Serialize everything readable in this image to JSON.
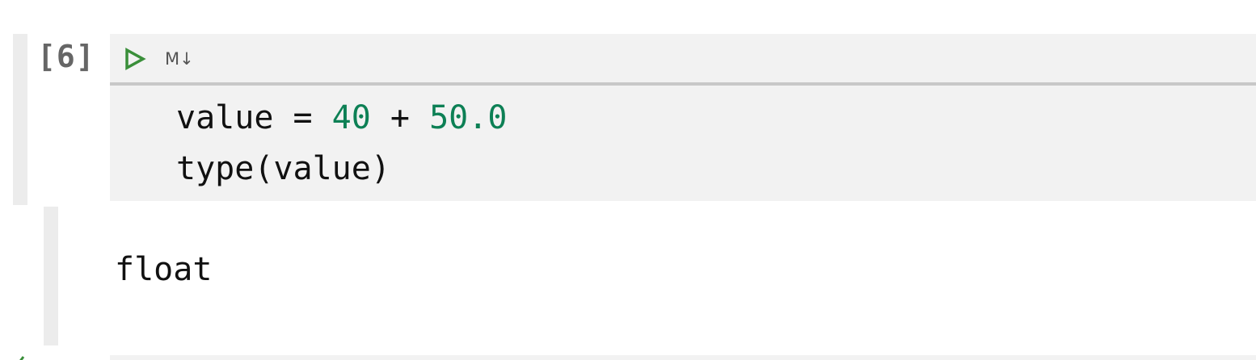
{
  "cell": {
    "execution_count": "[6]",
    "toolbar": {
      "run_icon": "play-icon",
      "markdown_label": "M↓"
    },
    "code_lines": [
      [
        {
          "text": "value = ",
          "kind": "plain"
        },
        {
          "text": "40",
          "kind": "number"
        },
        {
          "text": " + ",
          "kind": "plain"
        },
        {
          "text": "50.0",
          "kind": "number"
        }
      ],
      [
        {
          "text": "type(value)",
          "kind": "plain"
        }
      ]
    ],
    "output": "float"
  },
  "colors": {
    "number": "#0d8055",
    "run_icon": "#3a8f3a",
    "prompt": "#666666",
    "cell_background": "#f2f2f2"
  }
}
